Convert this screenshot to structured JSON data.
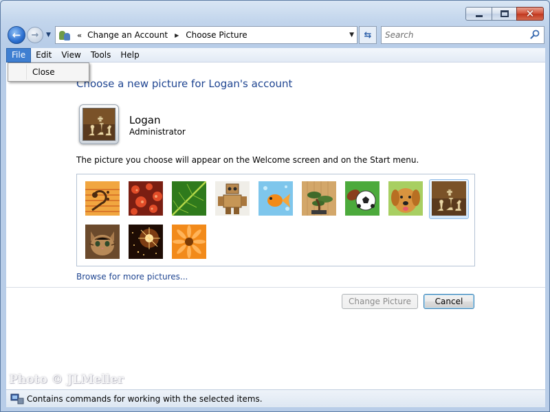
{
  "address_bar": {
    "crumbs": [
      "Change an Account",
      "Choose Picture"
    ]
  },
  "search": {
    "placeholder": "Search"
  },
  "menu": {
    "items": [
      {
        "label": "File",
        "active": true
      },
      {
        "label": "Edit"
      },
      {
        "label": "View"
      },
      {
        "label": "Tools"
      },
      {
        "label": "Help"
      }
    ],
    "file_dropdown": {
      "items": [
        "Close"
      ]
    }
  },
  "main": {
    "heading": "Choose a new picture for Logan's account",
    "account": {
      "name": "Logan",
      "role": "Administrator"
    },
    "description": "The picture you choose will appear on the Welcome screen and on the Start menu.",
    "pictures": [
      "bass-clef",
      "starfish",
      "leaf",
      "robot",
      "goldfish",
      "bonsai",
      "soccer-ball",
      "dog",
      "chess",
      "kitten",
      "sparkles",
      "daisy"
    ],
    "selected_picture": "chess",
    "browse_link": "Browse for more pictures...",
    "buttons": {
      "change": "Change Picture",
      "cancel": "Cancel"
    }
  },
  "watermark": "Photo © JLMeller",
  "status_bar": {
    "text": "Contains commands for working with the selected items."
  }
}
